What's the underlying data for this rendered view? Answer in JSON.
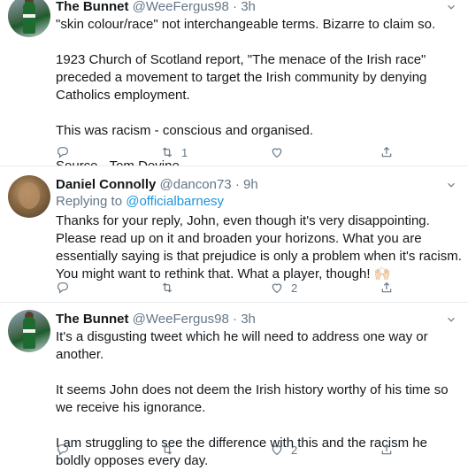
{
  "tweets": [
    {
      "author_name": "The Bunnet",
      "handle": "@WeeFergus98",
      "dot": "·",
      "time": "3h",
      "paragraphs": [
        "\"skin colour/race\" not interchangeable terms. Bizarre to claim so.",
        "1923 Church of Scotland report, \"The menace of the Irish race\" preceded a movement to target the Irish community by denying Catholics employment.",
        "This was racism - conscious and organised.",
        "Source - Tom Devine."
      ],
      "reply_count": "",
      "retweet_count": "1",
      "like_count": "",
      "avatar_icon": "avatar-footballer"
    },
    {
      "author_name": "Daniel Connolly",
      "handle": "@dancon73",
      "dot": "·",
      "time": "9h",
      "replying_prefix": "Replying to",
      "replying_to": "@officialbarnesy",
      "paragraphs": [
        "Thanks for your reply, John, even though it's very disappointing. Please read up on it and broaden your horizons. What you are essentially saying is that prejudice is only a problem when it's racism. You might want to rethink that. What a player, though! 🙌🏻"
      ],
      "reply_count": "",
      "retweet_count": "",
      "like_count": "2",
      "avatar_icon": "avatar-portrait"
    },
    {
      "author_name": "The Bunnet",
      "handle": "@WeeFergus98",
      "dot": "·",
      "time": "3h",
      "paragraphs": [
        "It's a disgusting tweet which he will need to address one way or another.",
        "It seems John does not deem the Irish history worthy of his time so we receive his ignorance.",
        "I am struggling to see the difference with this and the racism he boldly opposes every day."
      ],
      "reply_count": "",
      "retweet_count": "",
      "like_count": "2",
      "avatar_icon": "avatar-footballer"
    }
  ],
  "colors": {
    "text": "#14171a",
    "meta": "#657786",
    "link": "#1b95e0",
    "divider": "#e6ecf0"
  },
  "icons": [
    "reply-icon",
    "retweet-icon",
    "like-icon",
    "share-icon",
    "chevron-down-icon"
  ]
}
